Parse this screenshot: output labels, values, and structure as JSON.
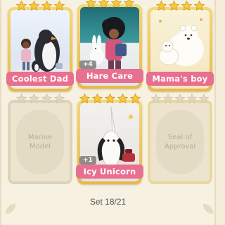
{
  "cards": [
    {
      "title": "Coolest Dad",
      "collected": true
    },
    {
      "title": "Hare Care",
      "collected": true,
      "badge": "+4"
    },
    {
      "title": "Mama's boy",
      "collected": true
    },
    {
      "title": "Marine\nModel",
      "collected": false
    },
    {
      "title": "Icy Unicorn",
      "collected": true,
      "badge": "+1"
    },
    {
      "title": "Seal of\nApproval",
      "collected": false
    }
  ],
  "footer": {
    "set_progress": "Set 18/21"
  },
  "colors": {
    "ribbon": "#e86f8f",
    "star": "#f6c83c",
    "frame": "#e8b84a"
  }
}
